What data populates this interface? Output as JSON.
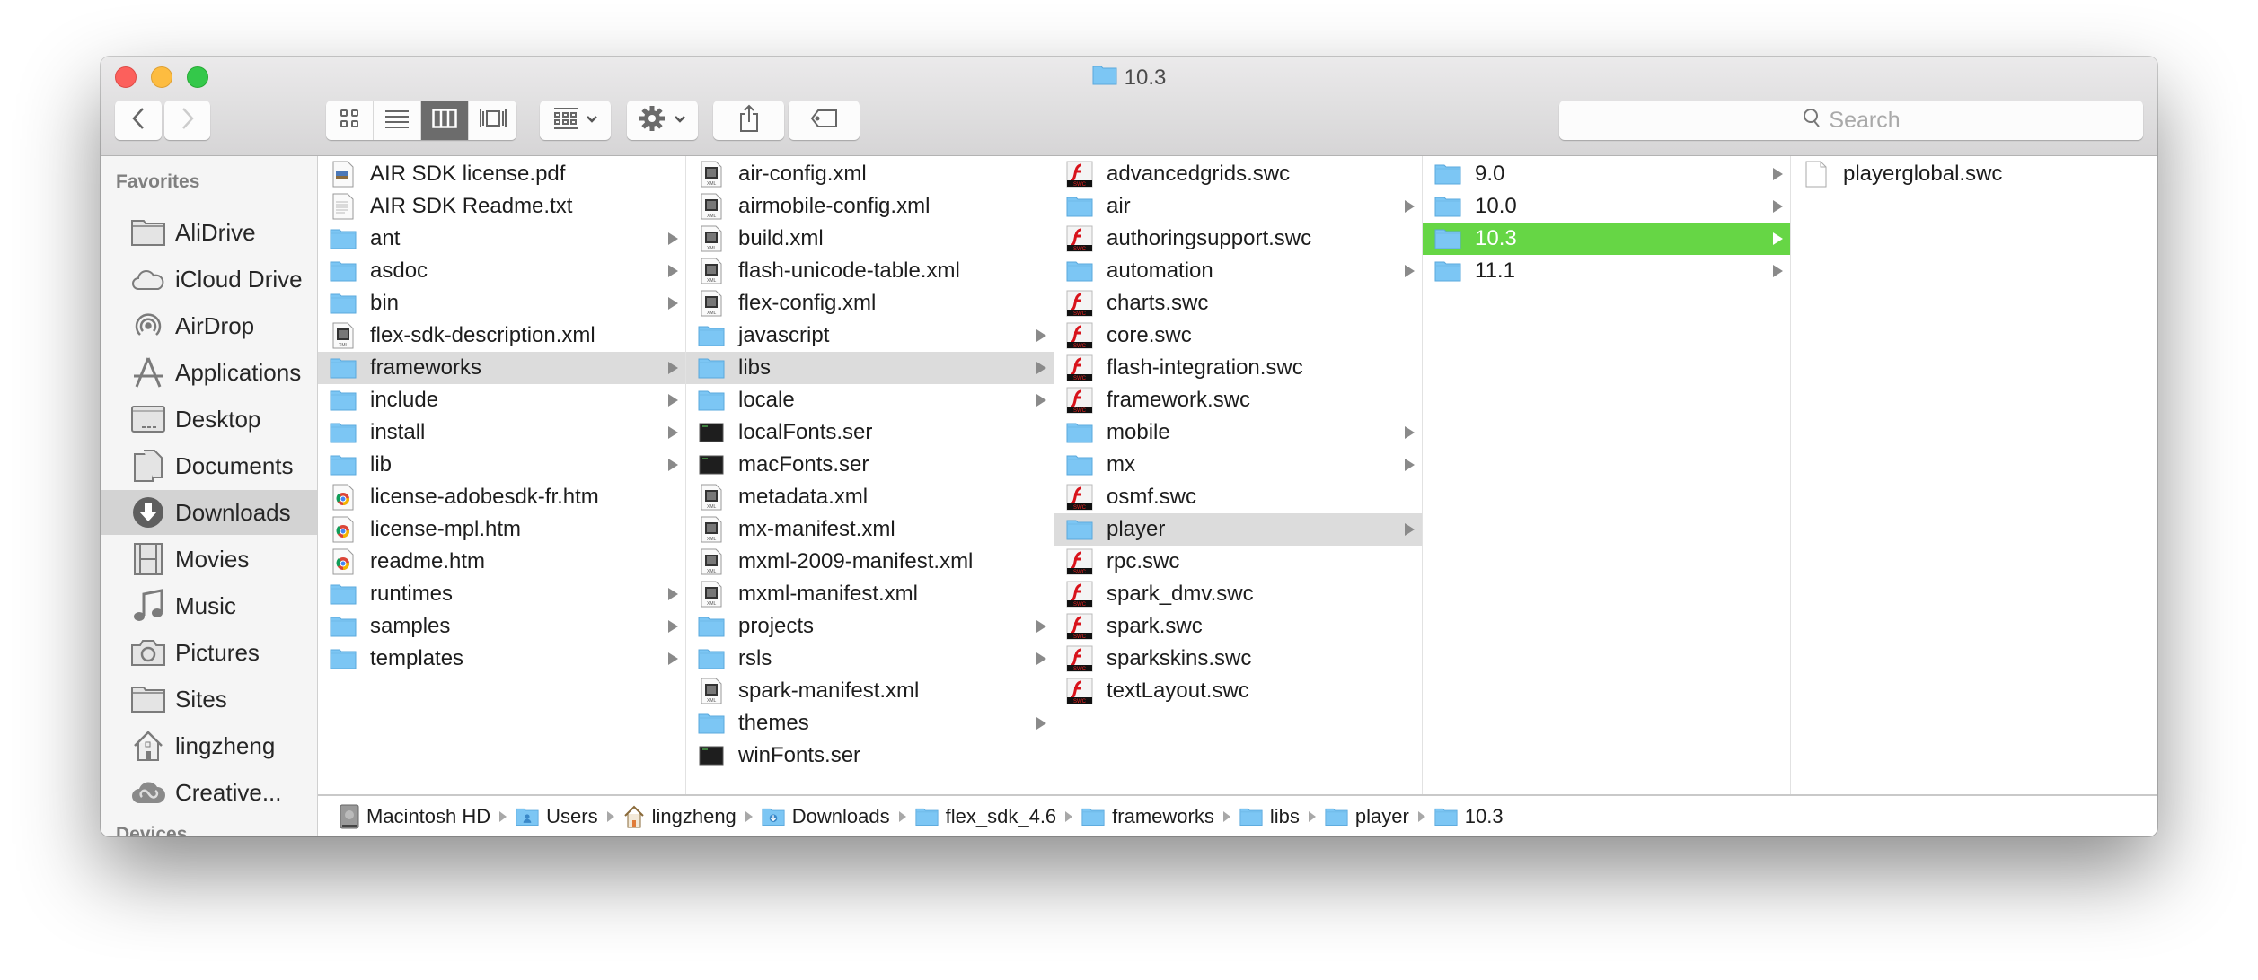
{
  "window": {
    "title": "10.3",
    "title_icon": "folder-icon"
  },
  "toolbar": {
    "back": "back-icon",
    "forward": "forward-icon",
    "view_modes": [
      {
        "name": "icon-view",
        "active": false
      },
      {
        "name": "list-view",
        "active": false
      },
      {
        "name": "column-view",
        "active": true
      },
      {
        "name": "coverflow-view",
        "active": false
      }
    ],
    "arrange": "arrange-icon",
    "action": "gear-icon",
    "share": "share-icon",
    "tags": "tag-icon",
    "search_placeholder": "Search"
  },
  "sidebar": {
    "heading": "Favorites",
    "items": [
      {
        "label": "AliDrive",
        "icon": "folder-icon",
        "selected": false
      },
      {
        "label": "iCloud Drive",
        "icon": "cloud-icon",
        "selected": false
      },
      {
        "label": "AirDrop",
        "icon": "airdrop-icon",
        "selected": false
      },
      {
        "label": "Applications",
        "icon": "applications-icon",
        "selected": false
      },
      {
        "label": "Desktop",
        "icon": "desktop-icon",
        "selected": false
      },
      {
        "label": "Documents",
        "icon": "documents-icon",
        "selected": false
      },
      {
        "label": "Downloads",
        "icon": "downloads-icon",
        "selected": true
      },
      {
        "label": "Movies",
        "icon": "movies-icon",
        "selected": false
      },
      {
        "label": "Music",
        "icon": "music-icon",
        "selected": false
      },
      {
        "label": "Pictures",
        "icon": "camera-icon",
        "selected": false
      },
      {
        "label": "Sites",
        "icon": "folder-icon",
        "selected": false
      },
      {
        "label": "lingzheng",
        "icon": "home-icon",
        "selected": false
      },
      {
        "label": "Creative...",
        "icon": "creative-cloud-icon",
        "selected": false
      }
    ],
    "devices_heading": "Devices"
  },
  "columns": [
    {
      "items": [
        {
          "name": "AIR SDK license.pdf",
          "type": "pdf",
          "folder": false
        },
        {
          "name": "AIR SDK Readme.txt",
          "type": "txt",
          "folder": false
        },
        {
          "name": "ant",
          "type": "folder",
          "folder": true
        },
        {
          "name": "asdoc",
          "type": "folder",
          "folder": true
        },
        {
          "name": "bin",
          "type": "folder",
          "folder": true
        },
        {
          "name": "flex-sdk-description.xml",
          "type": "xml",
          "folder": false
        },
        {
          "name": "frameworks",
          "type": "folder",
          "folder": true,
          "selected": "gray"
        },
        {
          "name": "include",
          "type": "folder",
          "folder": true
        },
        {
          "name": "install",
          "type": "folder",
          "folder": true
        },
        {
          "name": "lib",
          "type": "folder",
          "folder": true
        },
        {
          "name": "license-adobesdk-fr.htm",
          "type": "htm",
          "folder": false
        },
        {
          "name": "license-mpl.htm",
          "type": "htm",
          "folder": false
        },
        {
          "name": "readme.htm",
          "type": "htm",
          "folder": false
        },
        {
          "name": "runtimes",
          "type": "folder",
          "folder": true
        },
        {
          "name": "samples",
          "type": "folder",
          "folder": true
        },
        {
          "name": "templates",
          "type": "folder",
          "folder": true
        }
      ]
    },
    {
      "items": [
        {
          "name": "air-config.xml",
          "type": "xml",
          "folder": false
        },
        {
          "name": "airmobile-config.xml",
          "type": "xml",
          "folder": false
        },
        {
          "name": "build.xml",
          "type": "xml",
          "folder": false
        },
        {
          "name": "flash-unicode-table.xml",
          "type": "xml",
          "folder": false
        },
        {
          "name": "flex-config.xml",
          "type": "xml",
          "folder": false
        },
        {
          "name": "javascript",
          "type": "folder",
          "folder": true
        },
        {
          "name": "libs",
          "type": "folder",
          "folder": true,
          "selected": "gray"
        },
        {
          "name": "locale",
          "type": "folder",
          "folder": true
        },
        {
          "name": "localFonts.ser",
          "type": "exec",
          "folder": false
        },
        {
          "name": "macFonts.ser",
          "type": "exec",
          "folder": false
        },
        {
          "name": "metadata.xml",
          "type": "xml",
          "folder": false
        },
        {
          "name": "mx-manifest.xml",
          "type": "xml",
          "folder": false
        },
        {
          "name": "mxml-2009-manifest.xml",
          "type": "xml",
          "folder": false
        },
        {
          "name": "mxml-manifest.xml",
          "type": "xml",
          "folder": false
        },
        {
          "name": "projects",
          "type": "folder",
          "folder": true
        },
        {
          "name": "rsls",
          "type": "folder",
          "folder": true
        },
        {
          "name": "spark-manifest.xml",
          "type": "xml",
          "folder": false
        },
        {
          "name": "themes",
          "type": "folder",
          "folder": true
        },
        {
          "name": "winFonts.ser",
          "type": "exec",
          "folder": false
        }
      ]
    },
    {
      "items": [
        {
          "name": "advancedgrids.swc",
          "type": "swc",
          "folder": false
        },
        {
          "name": "air",
          "type": "folder",
          "folder": true
        },
        {
          "name": "authoringsupport.swc",
          "type": "swc",
          "folder": false
        },
        {
          "name": "automation",
          "type": "folder",
          "folder": true
        },
        {
          "name": "charts.swc",
          "type": "swc",
          "folder": false
        },
        {
          "name": "core.swc",
          "type": "swc",
          "folder": false
        },
        {
          "name": "flash-integration.swc",
          "type": "swc",
          "folder": false
        },
        {
          "name": "framework.swc",
          "type": "swc",
          "folder": false
        },
        {
          "name": "mobile",
          "type": "folder",
          "folder": true
        },
        {
          "name": "mx",
          "type": "folder",
          "folder": true
        },
        {
          "name": "osmf.swc",
          "type": "swc",
          "folder": false
        },
        {
          "name": "player",
          "type": "folder",
          "folder": true,
          "selected": "gray"
        },
        {
          "name": "rpc.swc",
          "type": "swc",
          "folder": false
        },
        {
          "name": "spark_dmv.swc",
          "type": "swc",
          "folder": false
        },
        {
          "name": "spark.swc",
          "type": "swc",
          "folder": false
        },
        {
          "name": "sparkskins.swc",
          "type": "swc",
          "folder": false
        },
        {
          "name": "textLayout.swc",
          "type": "swc",
          "folder": false
        }
      ]
    },
    {
      "items": [
        {
          "name": "9.0",
          "type": "folder",
          "folder": true
        },
        {
          "name": "10.0",
          "type": "folder",
          "folder": true
        },
        {
          "name": "10.3",
          "type": "folder",
          "folder": true,
          "selected": "green"
        },
        {
          "name": "11.1",
          "type": "folder",
          "folder": true
        }
      ]
    },
    {
      "items": [
        {
          "name": "playerglobal.swc",
          "type": "blank",
          "folder": false
        }
      ]
    }
  ],
  "pathbar": [
    {
      "label": "Macintosh HD",
      "icon": "hard-drive-icon"
    },
    {
      "label": "Users",
      "icon": "users-folder-icon"
    },
    {
      "label": "lingzheng",
      "icon": "home-icon"
    },
    {
      "label": "Downloads",
      "icon": "downloads-folder-icon"
    },
    {
      "label": "flex_sdk_4.6",
      "icon": "folder-icon"
    },
    {
      "label": "frameworks",
      "icon": "folder-icon"
    },
    {
      "label": "libs",
      "icon": "folder-icon"
    },
    {
      "label": "player",
      "icon": "folder-icon"
    },
    {
      "label": "10.3",
      "icon": "folder-icon"
    }
  ],
  "colors": {
    "selection_green": "#66d645",
    "selection_gray": "#dcdcdc",
    "folder_blue": "#7cc6f4"
  }
}
